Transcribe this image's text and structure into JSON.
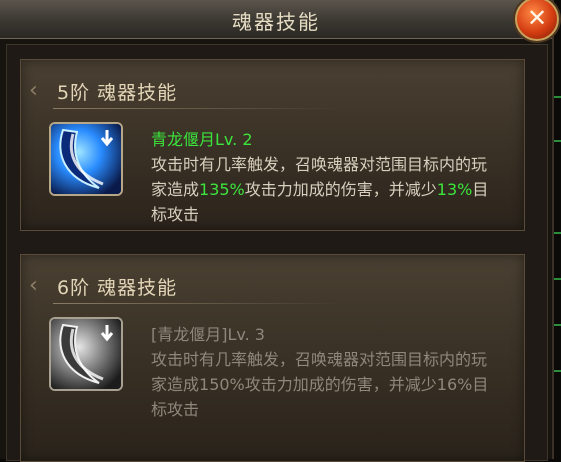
{
  "window": {
    "title": "魂器技能",
    "close_icon": "close-x-icon"
  },
  "skills": [
    {
      "tier_label": "5阶  魂器技能",
      "name": "青龙偃月Lv. 2",
      "icon": "blade-arrow-icon",
      "state": "active",
      "desc": {
        "p1": "攻击时有几率触发，召唤魂器对范围目标内的玩家造成",
        "v1": "135%",
        "p2": "攻击力加成的伤害，并减少",
        "v2": "13%",
        "p3": "目标攻击"
      }
    },
    {
      "tier_label": "6阶  魂器技能",
      "name": "[青龙偃月]Lv. 3",
      "icon": "blade-arrow-icon",
      "state": "locked",
      "desc": {
        "p1": "攻击时有几率触发，召唤魂器对范围目标内的玩家造成",
        "v1": "150%",
        "p2": "攻击力加成的伤害，并减少",
        "v2": "16%",
        "p3": "目标攻击"
      }
    }
  ],
  "colors": {
    "highlight_green": "#3be53b",
    "locked_gray": "#8f877b",
    "text_light": "#d8cfbe"
  }
}
